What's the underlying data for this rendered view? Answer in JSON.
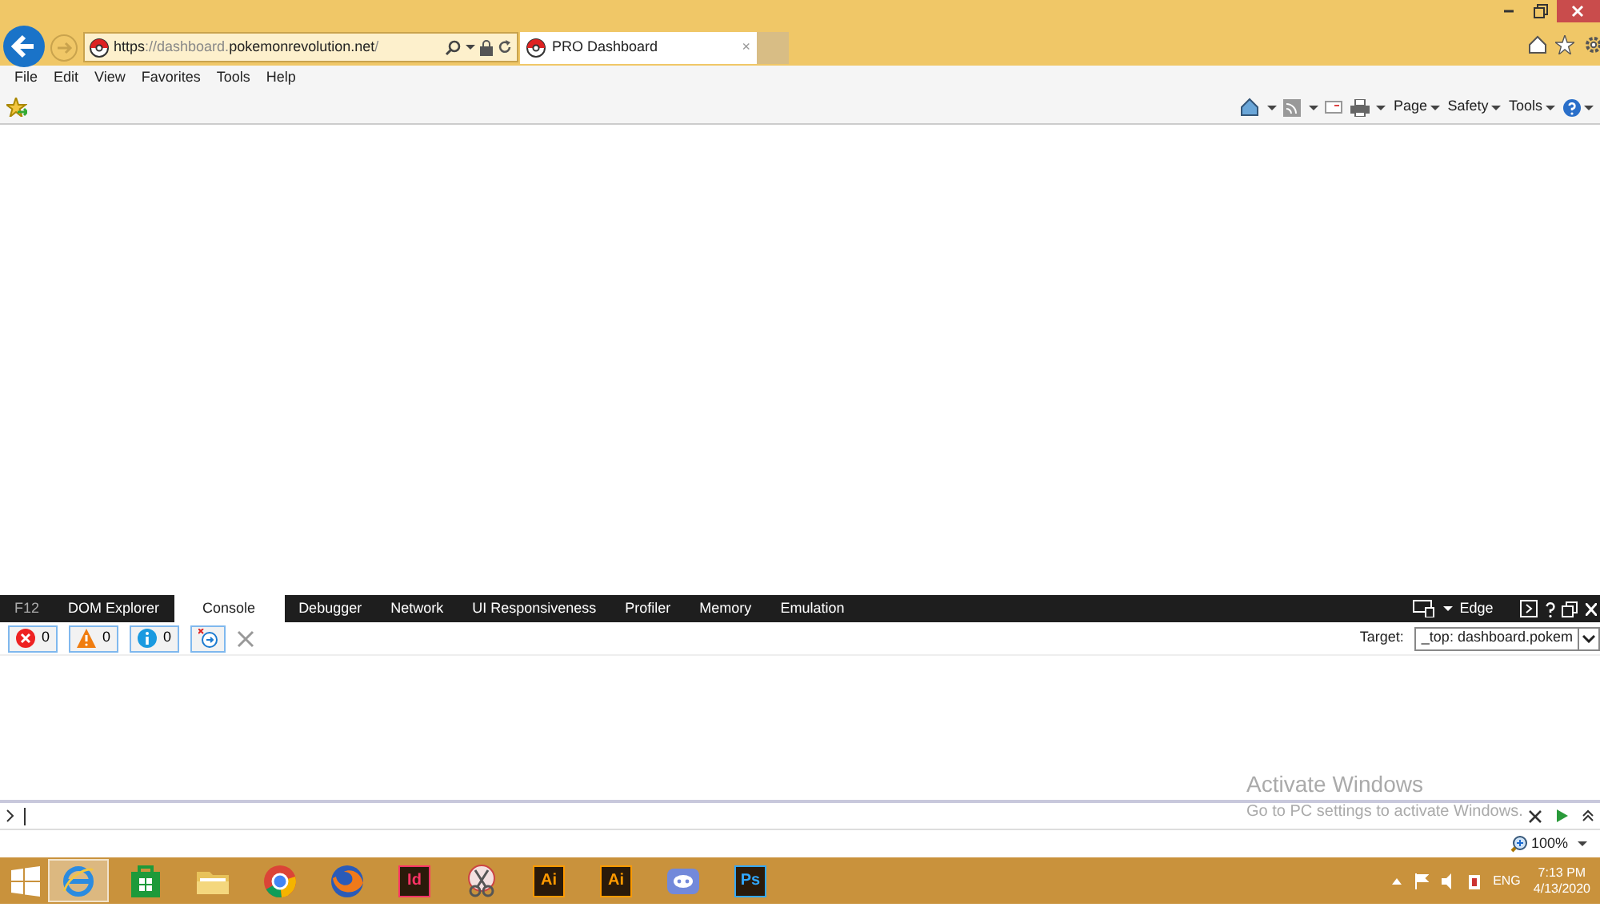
{
  "browser": {
    "url_parts": [
      {
        "text": "https",
        "dim": false
      },
      {
        "text": "://dashboard.",
        "dim": true
      },
      {
        "text": "pokemonrevolution.net",
        "dim": false
      },
      {
        "text": "/",
        "dim": true
      }
    ],
    "tab": {
      "title": "PRO Dashboard",
      "close": "×"
    },
    "menu": [
      "File",
      "Edit",
      "View",
      "Favorites",
      "Tools",
      "Help"
    ],
    "command_bar": [
      "Page",
      "Safety",
      "Tools"
    ]
  },
  "devtools": {
    "label": "F12",
    "tabs": [
      {
        "label": "DOM Explorer",
        "selected": false
      },
      {
        "label": "Console",
        "selected": true
      },
      {
        "label": "Debugger",
        "selected": false
      },
      {
        "label": "Network",
        "selected": false
      },
      {
        "label": "UI Responsiveness",
        "selected": false
      },
      {
        "label": "Profiler",
        "selected": false
      },
      {
        "label": "Memory",
        "selected": false
      },
      {
        "label": "Emulation",
        "selected": false
      }
    ],
    "mode": "Edge",
    "counters": [
      {
        "kind": "error",
        "count": "0"
      },
      {
        "kind": "warning",
        "count": "0"
      },
      {
        "kind": "info",
        "count": "0"
      }
    ],
    "target_label": "Target:",
    "target_value": "_top: dashboard.pokem",
    "zoom": "100%"
  },
  "activation_notice": {
    "title": "Activate Windows",
    "subtitle": "Go to PC settings to activate Windows."
  },
  "taskbar": {
    "apps": [
      {
        "kind": "ie",
        "active": true
      },
      {
        "kind": "store",
        "active": false
      },
      {
        "kind": "folder",
        "active": false
      },
      {
        "kind": "chrome",
        "active": false
      },
      {
        "kind": "firefox",
        "active": false
      },
      {
        "kind": "tile",
        "label": "Id",
        "color": "#ff3366",
        "active": false
      },
      {
        "kind": "snip",
        "active": false
      },
      {
        "kind": "tile",
        "label": "Ai",
        "color": "#ff9a00",
        "active": false
      },
      {
        "kind": "tile",
        "label": "Ai",
        "color": "#ff9a00",
        "active": false
      },
      {
        "kind": "discord",
        "active": false
      },
      {
        "kind": "tile",
        "label": "Ps",
        "color": "#31a8ff",
        "active": false
      }
    ],
    "language": "ENG",
    "time": "7:13 PM",
    "date": "4/13/2020"
  }
}
